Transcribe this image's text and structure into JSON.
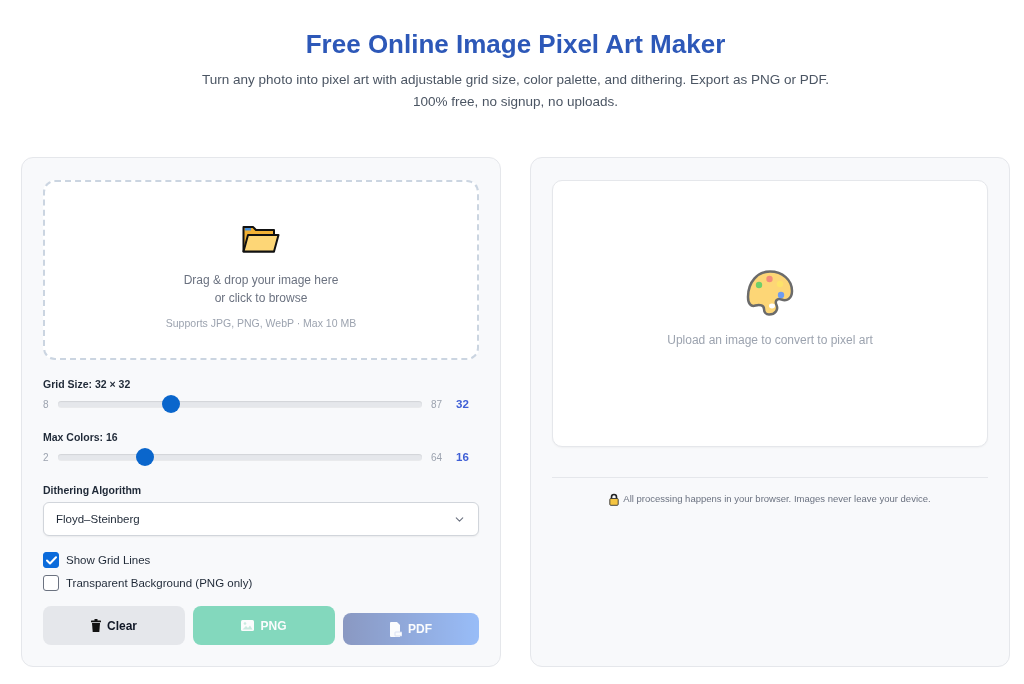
{
  "header": {
    "title": "Free Online Image Pixel Art Maker",
    "subtitle_lines": [
      "Turn any photo into pixel art with adjustable grid size, color palette, and dithering. Export as PNG or PDF.",
      "100% free, no signup, no uploads."
    ]
  },
  "upload": {
    "lines": [
      "Drag & drop your image here",
      "or click to browse"
    ],
    "hint": "Supports JPG, PNG, WebP · Max 10 MB"
  },
  "sliders": [
    {
      "label": "Grid Size: 32 × 32",
      "min": "8",
      "max": "87",
      "value": "32",
      "level": 0.31
    },
    {
      "label": "Max Colors: 16",
      "min": "2",
      "max": "64",
      "value": "16",
      "level": 0.24
    }
  ],
  "dithering": {
    "label": "Dithering Algorithm",
    "value": "Floyd–Steinberg"
  },
  "options": [
    {
      "label": "Show Grid Lines",
      "checked": true
    },
    {
      "label": "Transparent Background (PNG only)",
      "checked": false
    }
  ],
  "buttons": [
    {
      "kind": "clear",
      "label": "Clear",
      "disabled": false
    },
    {
      "kind": "png",
      "label": "PNG",
      "disabled": true
    },
    {
      "kind": "pdf",
      "label": "PDF",
      "disabled": true
    }
  ],
  "preview": {
    "message": "Upload an image to convert to pixel art"
  },
  "privacy_note": "All processing happens in your browser. Images never leave your device."
}
